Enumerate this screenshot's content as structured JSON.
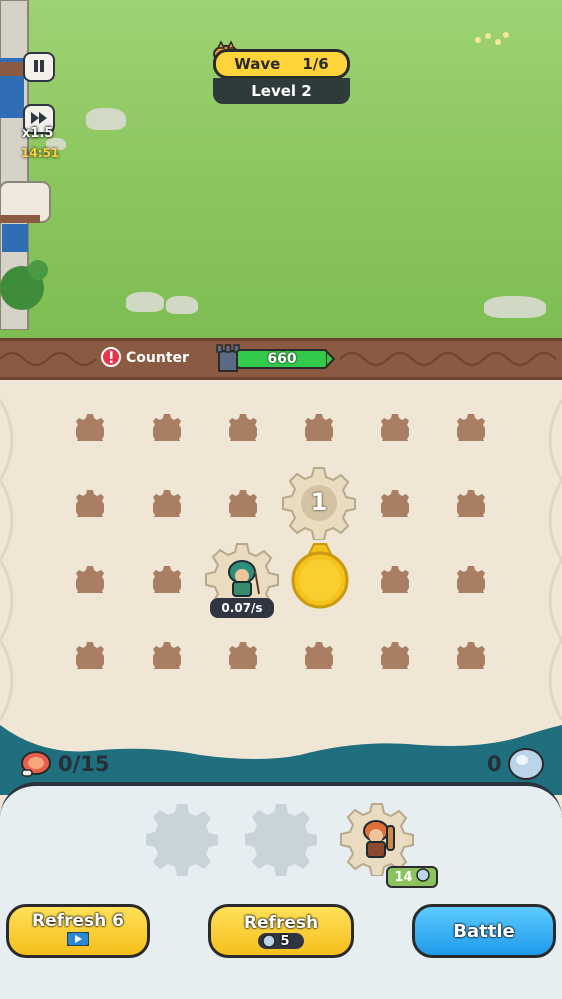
{
  "hud": {
    "speed_label": "x1.5",
    "timer": "14:51",
    "wave_label": "Wave",
    "wave_value": "1/6",
    "level_label": "Level 2"
  },
  "enemy_bar": {
    "counter_label": "Counter",
    "castle_hp": "660",
    "castle_hp_fraction": 1.0
  },
  "board": {
    "merge_level": "1",
    "hero_rate": "0.07/s"
  },
  "resources": {
    "meat": "0/15",
    "gems": "0"
  },
  "shop": {
    "price": "14",
    "refresh_ad_label": "Refresh 6",
    "refresh_label": "Refresh",
    "refresh_cost": "5",
    "battle_label": "Battle"
  },
  "colors": {
    "grass": "#8bc65d",
    "wood": "#8a5a43",
    "board": "#efe6d6",
    "water": "#1f6f7f",
    "accent_yellow": "#ffd43b",
    "accent_blue": "#1e9aea",
    "hp_green": "#33c94a"
  },
  "icons": [
    "pause-icon",
    "fast-forward-icon",
    "cat-icon",
    "alert-icon",
    "tower-icon",
    "meat-icon",
    "gem-icon",
    "play-video-icon",
    "gear-slot-icon"
  ]
}
